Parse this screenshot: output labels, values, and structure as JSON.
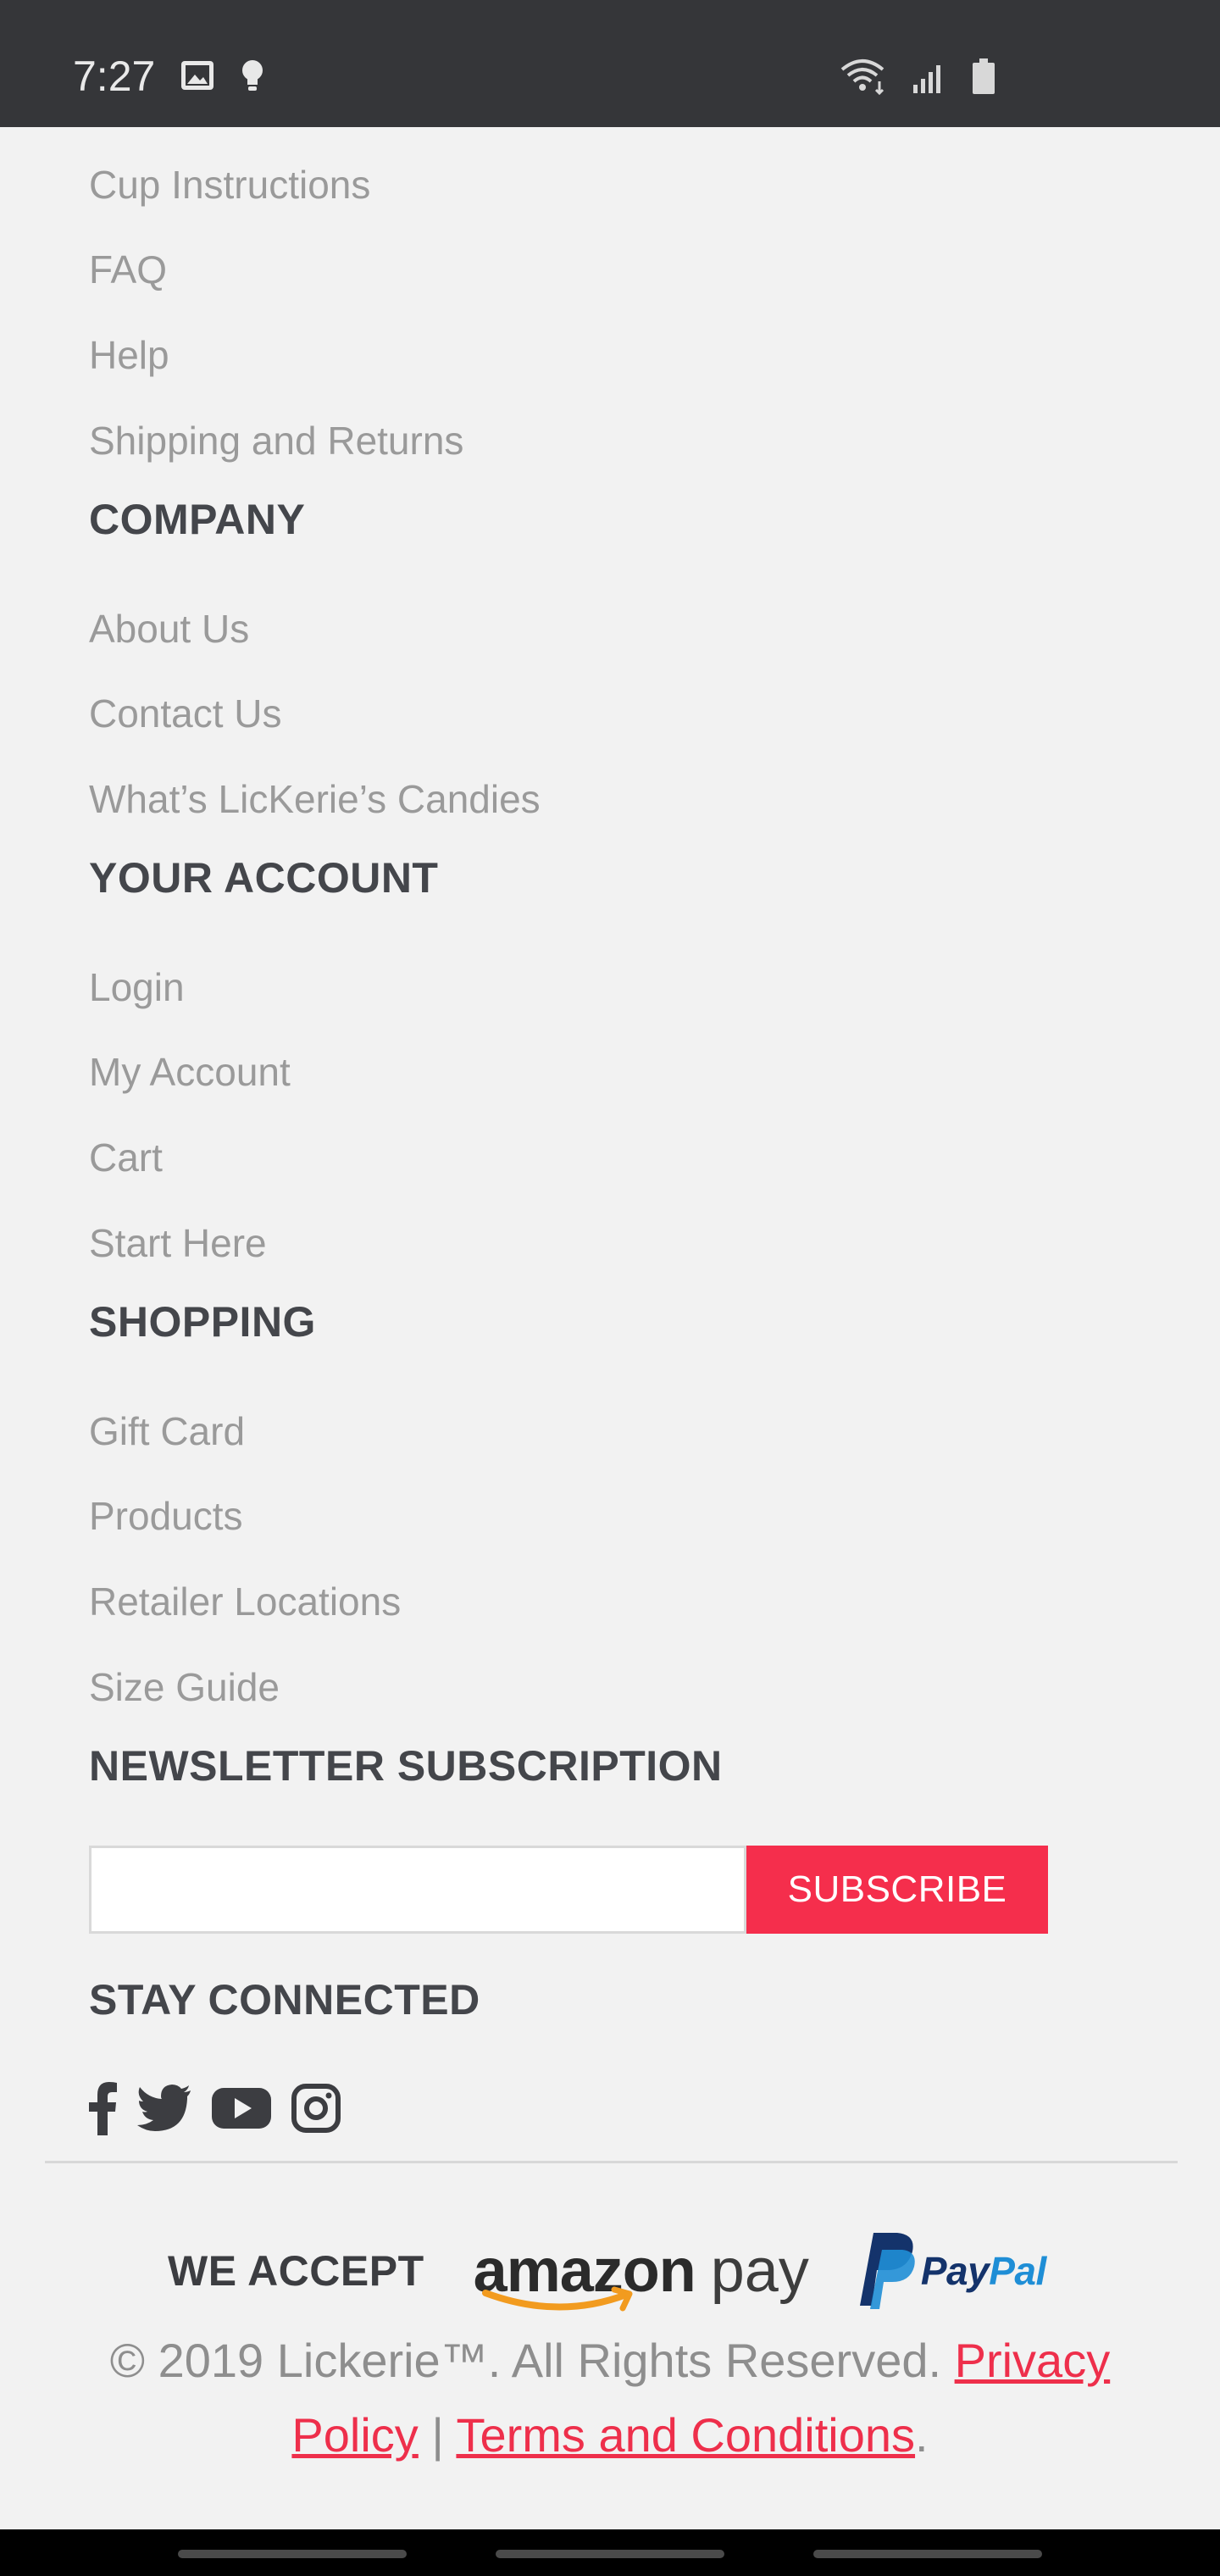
{
  "status_bar": {
    "time": "7:27",
    "left_icons": [
      "image-icon",
      "bulb-icon"
    ],
    "right_icons": [
      "wifi-icon",
      "signal-icon",
      "battery-icon"
    ]
  },
  "footer": {
    "support_links": [
      "Cup Instructions",
      "FAQ",
      "Help",
      "Shipping and Returns"
    ],
    "company_heading": "COMPANY",
    "company_links": [
      "About Us",
      "Contact Us",
      "What’s LicKerie’s Candies"
    ],
    "account_heading": "YOUR ACCOUNT",
    "account_links": [
      "Login",
      "My Account",
      "Cart",
      "Start Here"
    ],
    "shopping_heading": "SHOPPING",
    "shopping_links": [
      "Gift Card",
      "Products",
      "Retailer Locations",
      "Size Guide"
    ],
    "newsletter_heading": "NEWSLETTER SUBSCRIPTION",
    "newsletter_input_placeholder": "",
    "subscribe_label": "SUBSCRIBE",
    "social_heading": "STAY CONNECTED",
    "social_icons": [
      "facebook-icon",
      "twitter-icon",
      "youtube-icon",
      "instagram-icon"
    ]
  },
  "payment": {
    "label": "WE ACCEPT",
    "amazon_word": "amazon",
    "amazon_pay_word": "pay",
    "paypal_word_1": "Pay",
    "paypal_word_2": "Pal"
  },
  "copyright": {
    "text": "© 2019 Lickerie™. All Rights Reserved.",
    "privacy_link": "Privacy Policy",
    "separator": "|",
    "terms_link": "Terms and Conditions",
    "end": "."
  },
  "colors": {
    "accent": "#f52e4c",
    "link_gray": "#9a9a9a",
    "heading_dark": "#44464b",
    "status_bar_bg": "#353639",
    "page_bg": "#f2f2f2"
  }
}
